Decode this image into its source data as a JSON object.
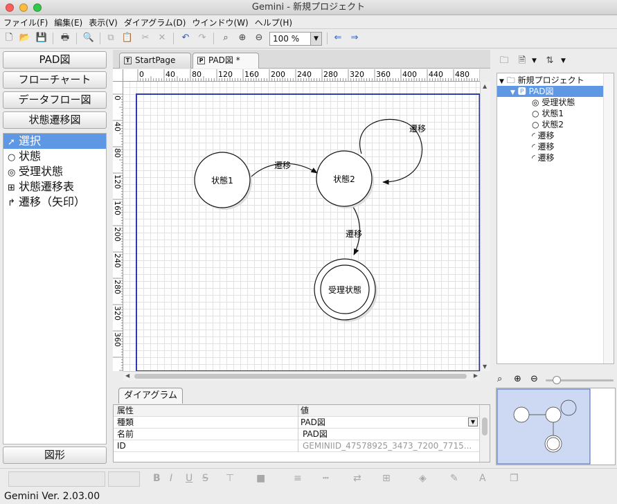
{
  "window": {
    "title": "Gemini - 新規プロジェクト"
  },
  "menu": [
    "ファイル(F)",
    "編集(E)",
    "表示(V)",
    "ダイアグラム(D)",
    "ウインドウ(W)",
    "ヘルプ(H)"
  ],
  "toolbar": {
    "zoom": "100 %"
  },
  "left": {
    "buttons": [
      "PAD図",
      "フローチャート",
      "データフロー図",
      "状態遷移図"
    ],
    "tools": [
      {
        "label": "選択",
        "icon": "cursor-icon",
        "selected": true
      },
      {
        "label": "状態",
        "icon": "circle-icon"
      },
      {
        "label": "受理状態",
        "icon": "double-circle-icon"
      },
      {
        "label": "状態遷移表",
        "icon": "table-icon"
      },
      {
        "label": "遷移（矢印）",
        "icon": "arrow-icon"
      }
    ],
    "shape_button": "図形"
  },
  "tabs": [
    {
      "label": "StartPage",
      "icon": "T"
    },
    {
      "label": "PAD図 *",
      "icon": "P"
    }
  ],
  "ruler": {
    "h": [
      "0",
      "40",
      "80",
      "120",
      "160",
      "200",
      "240",
      "280",
      "320",
      "360",
      "400",
      "440",
      "480"
    ],
    "v": [
      "0",
      "40",
      "80",
      "120",
      "160",
      "200",
      "240",
      "280",
      "320",
      "360"
    ]
  },
  "diagram": {
    "states": [
      "状態1",
      "状態2",
      "受理状態"
    ],
    "transitions": [
      "遷移",
      "遷移",
      "遷移"
    ]
  },
  "properties": {
    "tab": "ダイアグラム",
    "header": [
      "属性",
      "値"
    ],
    "rows": [
      {
        "name": "種類",
        "value": "PAD図"
      },
      {
        "name": "名前",
        "value": "PAD図"
      },
      {
        "name": "ID",
        "value": "GEMINIID_47578925_3473_7200_7715..."
      }
    ]
  },
  "tree": {
    "root": "新規プロジェクト",
    "diagram": "PAD図",
    "items": [
      {
        "label": "受理状態",
        "icon": "double-circle-icon"
      },
      {
        "label": "状態1",
        "icon": "circle-icon"
      },
      {
        "label": "状態2",
        "icon": "circle-icon"
      },
      {
        "label": "遷移",
        "icon": "transition-icon"
      },
      {
        "label": "遷移",
        "icon": "transition-icon"
      },
      {
        "label": "遷移",
        "icon": "transition-icon"
      }
    ]
  },
  "status": "Gemini  Ver. 2.03.00"
}
